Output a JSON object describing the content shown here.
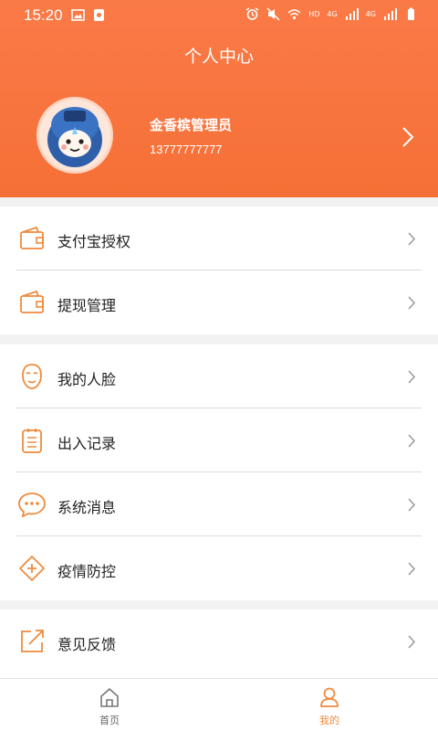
{
  "status_bar": {
    "time": "15:20",
    "network_labels": [
      "HD",
      "4G",
      "4G"
    ]
  },
  "header": {
    "title": "个人中心"
  },
  "profile": {
    "name": "金香槟管理员",
    "phone": "13777777777"
  },
  "menu_groups": [
    [
      {
        "label": "支付宝授权",
        "icon": "wallet-icon"
      },
      {
        "label": "提现管理",
        "icon": "wallet-icon"
      }
    ],
    [
      {
        "label": "我的人脸",
        "icon": "face-icon"
      },
      {
        "label": "出入记录",
        "icon": "clipboard-icon"
      },
      {
        "label": "系统消息",
        "icon": "chat-bubble-icon"
      },
      {
        "label": "疫情防控",
        "icon": "plus-diamond-icon"
      }
    ],
    [
      {
        "label": "意见反馈",
        "icon": "edit-arrow-icon"
      }
    ]
  ],
  "tabbar": {
    "home_label": "首页",
    "mine_label": "我的",
    "active_tab": "mine"
  },
  "colors": {
    "accent": "#f47035",
    "icon_orange": "#f08a3c",
    "inactive_tab": "#666666",
    "chevron": "#999999"
  }
}
